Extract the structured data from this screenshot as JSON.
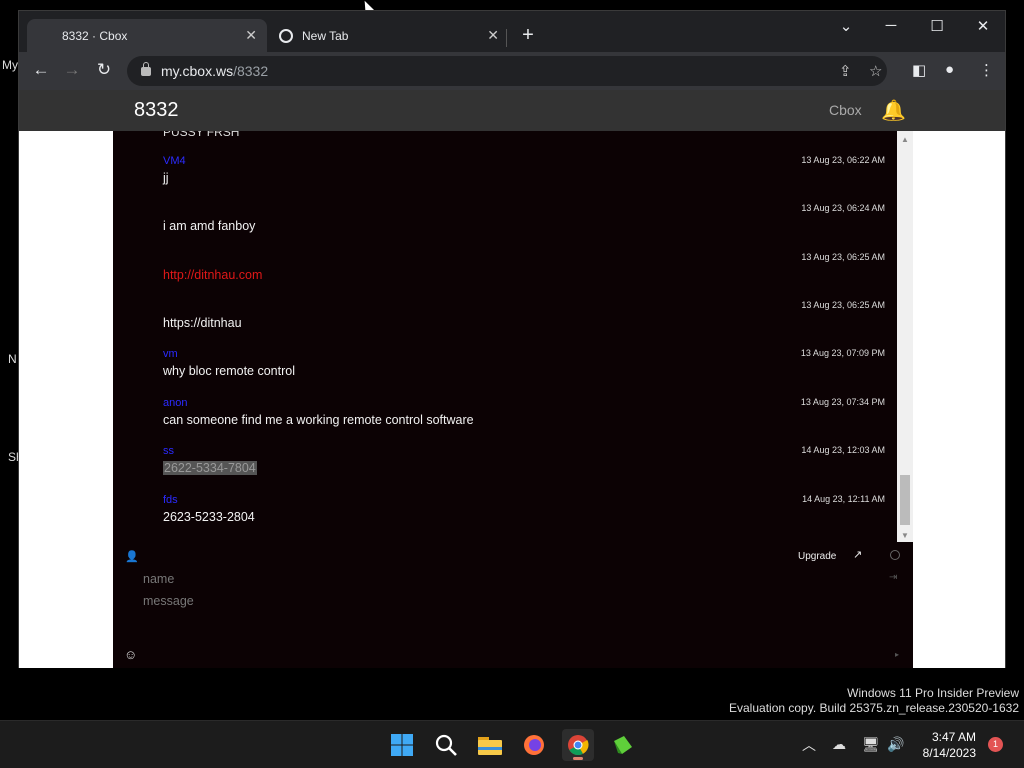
{
  "desktop": {
    "labels": [
      "My",
      "N",
      "Sh"
    ]
  },
  "browser": {
    "tabs": [
      {
        "title": "8332 · Cbox",
        "close": "✕"
      },
      {
        "title": "New Tab",
        "close": "✕"
      }
    ],
    "new_tab": "+",
    "window_controls": {
      "dropdown": "⌄",
      "minimize": "─",
      "maximize": "☐",
      "close": "✕"
    },
    "nav": {
      "back": "←",
      "forward": "→",
      "reload": "↻"
    },
    "url_host": "my.cbox.ws",
    "url_path": "/8332",
    "toolbar_icons": {
      "share": "⇪",
      "bookmark": "☆",
      "sidebar": "◧",
      "profile": "●",
      "menu": "⋮"
    }
  },
  "cbox": {
    "title": "8332",
    "brand": "Cbox",
    "bell": "🔔",
    "cut_top_text": "PUSSY FRSH",
    "messages": [
      {
        "name": "VM4",
        "time": "13 Aug 23, 06:22 AM",
        "text": "jj",
        "style": ""
      },
      {
        "name": "",
        "time": "13 Aug 23, 06:24 AM",
        "text": "i am amd fanboy",
        "style": ""
      },
      {
        "name": "",
        "time": "13 Aug 23, 06:25 AM",
        "text": "http://ditnhau.com",
        "style": "link"
      },
      {
        "name": "",
        "time": "13 Aug 23, 06:25 AM",
        "text": "https://ditnhau",
        "style": ""
      },
      {
        "name": "vm",
        "time": "13 Aug 23, 07:09 PM",
        "text": "why bloc remote control",
        "style": ""
      },
      {
        "name": "anon",
        "time": "13 Aug 23, 07:34 PM",
        "text": "can someone find me a working remote control software",
        "style": ""
      },
      {
        "name": "ss",
        "time": "14 Aug 23, 12:03 AM",
        "text": "2622-5334-7804",
        "style": "selected"
      },
      {
        "name": "fds",
        "time": "14 Aug 23, 12:11 AM",
        "text": "2623-5233-2804",
        "style": ""
      }
    ],
    "compose": {
      "user_icon": "👤",
      "upgrade": "Upgrade",
      "external_icon": "↗",
      "name_placeholder": "name",
      "message_placeholder": "message",
      "emoji_icon": "☺",
      "send_icon": "▸",
      "login_icon": "⇥"
    }
  },
  "watermark": {
    "line1": "Windows 11 Pro Insider Preview",
    "line2": "Evaluation copy. Build 25375.zn_release.230520-1632"
  },
  "taskbar": {
    "time": "3:47 AM",
    "date": "8/14/2023",
    "notifications": "1",
    "tray": {
      "chevron": "︿",
      "cloud": "☁",
      "network": "🖥",
      "volume": "🔊"
    }
  },
  "colors": {
    "chat_bg": "#0c0204",
    "username": "#2b2bff",
    "link": "#e01818",
    "header_bg": "#333333"
  }
}
